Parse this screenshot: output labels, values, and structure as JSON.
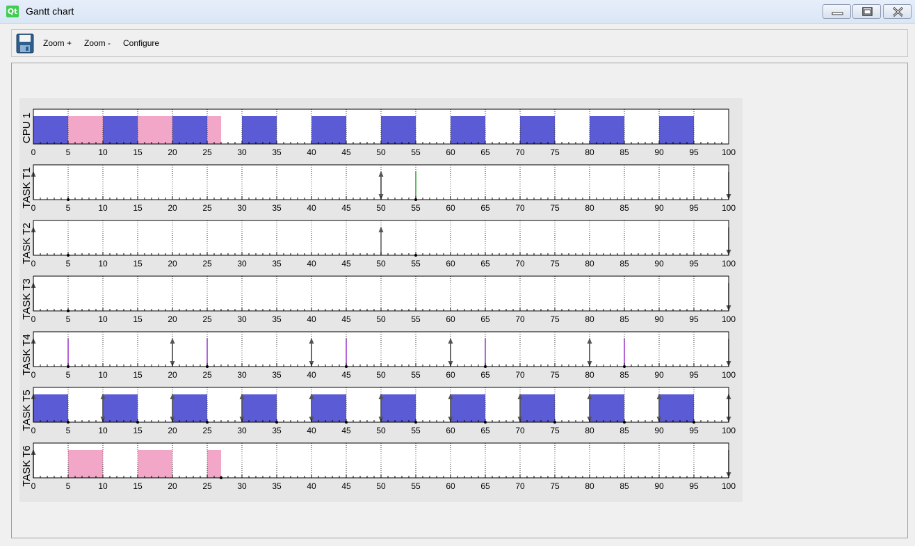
{
  "window": {
    "title": "Gantt chart",
    "app_icon_text": "Qt",
    "app_icon_name": "qt-logo-icon",
    "controls": [
      {
        "name": "minimize-icon"
      },
      {
        "name": "maximize-icon"
      },
      {
        "name": "close-icon"
      }
    ]
  },
  "toolbar": {
    "save_icon": "save-icon",
    "zoom_in_label": "Zoom +",
    "zoom_out_label": "Zoom -",
    "configure_label": "Configure"
  },
  "chart_data": {
    "type": "gantt",
    "x_ticks": [
      0,
      5,
      10,
      15,
      20,
      25,
      30,
      35,
      40,
      45,
      50,
      55,
      60,
      65,
      70,
      75,
      80,
      85,
      90,
      95,
      100
    ],
    "xlim": [
      0,
      100
    ],
    "colors": {
      "blue": "#5b5bd6",
      "pink": "#f2a7c8",
      "arrow": "#555555",
      "green": "#2e9e2e",
      "purple": "#9b30c8"
    },
    "rows": [
      {
        "label": "CPU 1",
        "bars": [
          {
            "start": 0,
            "end": 5,
            "color": "blue"
          },
          {
            "start": 5,
            "end": 10,
            "color": "pink"
          },
          {
            "start": 10,
            "end": 15,
            "color": "blue"
          },
          {
            "start": 15,
            "end": 20,
            "color": "pink"
          },
          {
            "start": 20,
            "end": 25,
            "color": "blue"
          },
          {
            "start": 25,
            "end": 27,
            "color": "pink"
          },
          {
            "start": 30,
            "end": 35,
            "color": "blue"
          },
          {
            "start": 40,
            "end": 45,
            "color": "blue"
          },
          {
            "start": 50,
            "end": 55,
            "color": "blue"
          },
          {
            "start": 60,
            "end": 65,
            "color": "blue"
          },
          {
            "start": 70,
            "end": 75,
            "color": "blue"
          },
          {
            "start": 80,
            "end": 85,
            "color": "blue"
          },
          {
            "start": 90,
            "end": 95,
            "color": "blue"
          }
        ],
        "up_arrows": [],
        "down_arrows": [],
        "marks": [],
        "deadlines": []
      },
      {
        "label": "TASK T1",
        "bars": [],
        "up_arrows": [
          0,
          50
        ],
        "down_arrows": [
          50,
          100
        ],
        "marks": [
          {
            "t": 55,
            "color": "green"
          }
        ],
        "deadlines": [
          5,
          55
        ]
      },
      {
        "label": "TASK T2",
        "bars": [],
        "up_arrows": [
          0,
          50
        ],
        "down_arrows": [
          100
        ],
        "marks": [],
        "deadlines": [
          5,
          55
        ]
      },
      {
        "label": "TASK T3",
        "bars": [],
        "up_arrows": [
          0
        ],
        "down_arrows": [
          100
        ],
        "marks": [],
        "deadlines": [
          5
        ]
      },
      {
        "label": "TASK T4",
        "bars": [],
        "up_arrows": [
          0,
          20,
          40,
          60,
          80
        ],
        "down_arrows": [
          20,
          40,
          60,
          80,
          100
        ],
        "marks": [
          {
            "t": 5,
            "color": "purple"
          },
          {
            "t": 25,
            "color": "purple"
          },
          {
            "t": 45,
            "color": "purple"
          },
          {
            "t": 65,
            "color": "purple"
          },
          {
            "t": 85,
            "color": "purple"
          }
        ],
        "deadlines": [
          5,
          25,
          45,
          65,
          85
        ]
      },
      {
        "label": "TASK T5",
        "bars": [
          {
            "start": 0,
            "end": 5,
            "color": "blue"
          },
          {
            "start": 10,
            "end": 15,
            "color": "blue"
          },
          {
            "start": 20,
            "end": 25,
            "color": "blue"
          },
          {
            "start": 30,
            "end": 35,
            "color": "blue"
          },
          {
            "start": 40,
            "end": 45,
            "color": "blue"
          },
          {
            "start": 50,
            "end": 55,
            "color": "blue"
          },
          {
            "start": 60,
            "end": 65,
            "color": "blue"
          },
          {
            "start": 70,
            "end": 75,
            "color": "blue"
          },
          {
            "start": 80,
            "end": 85,
            "color": "blue"
          },
          {
            "start": 90,
            "end": 95,
            "color": "blue"
          }
        ],
        "up_arrows": [
          0,
          10,
          20,
          30,
          40,
          50,
          60,
          70,
          80,
          90,
          100
        ],
        "down_arrows": [
          10,
          20,
          30,
          40,
          50,
          60,
          70,
          80,
          90,
          100
        ],
        "marks": [],
        "deadlines": [
          5,
          15,
          25,
          35,
          45,
          55,
          65,
          75,
          85,
          95
        ]
      },
      {
        "label": "TASK T6",
        "bars": [
          {
            "start": 5,
            "end": 10,
            "color": "pink"
          },
          {
            "start": 15,
            "end": 20,
            "color": "pink"
          },
          {
            "start": 25,
            "end": 27,
            "color": "pink"
          }
        ],
        "up_arrows": [
          0
        ],
        "down_arrows": [
          100
        ],
        "marks": [],
        "deadlines": [
          27
        ]
      }
    ]
  }
}
